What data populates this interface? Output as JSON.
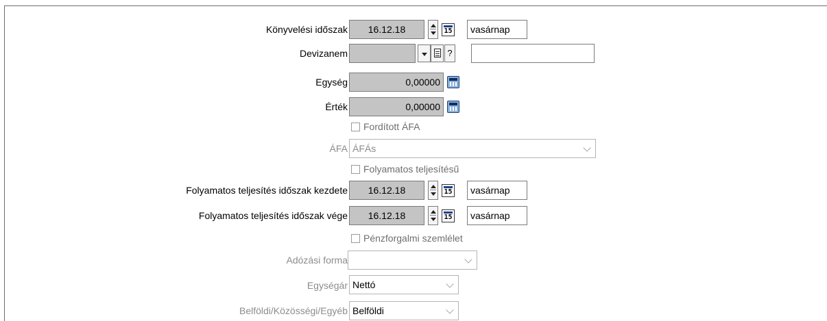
{
  "labels": {
    "period": "Könyvelési időszak",
    "currency": "Devizanem",
    "unit": "Egység",
    "value": "Érték",
    "vat": "ÁFA",
    "cont_start": "Folyamatos teljesítés időszak kezdete",
    "cont_end": "Folyamatos teljesítés időszak vége",
    "tax_form": "Adózási forma",
    "unit_price": "Egységár",
    "domestic": "Belföldi/Közösségi/Egyéb"
  },
  "period": {
    "date": "16.12.18",
    "day": "vasárnap",
    "cal_icon_text": "15"
  },
  "currency": {
    "value": "",
    "help_label": "?",
    "text_value": ""
  },
  "unit": {
    "value": "0,00000"
  },
  "value": {
    "value": "0,00000"
  },
  "checkboxes": {
    "reverse_vat": "Fordított ÁFA",
    "continuous": "Folyamatos teljesítésű",
    "cash_basis": "Pénzforgalmi szemlélet"
  },
  "vat_select": {
    "selected": "ÁFÁs"
  },
  "cont_start": {
    "date": "16.12.18",
    "day": "vasárnap",
    "cal_icon_text": "15"
  },
  "cont_end": {
    "date": "16.12.18",
    "day": "vasárnap",
    "cal_icon_text": "15"
  },
  "tax_form_select": {
    "selected": ""
  },
  "unit_price_select": {
    "selected": "Nettó"
  },
  "domestic_select": {
    "selected": "Belföldi"
  }
}
